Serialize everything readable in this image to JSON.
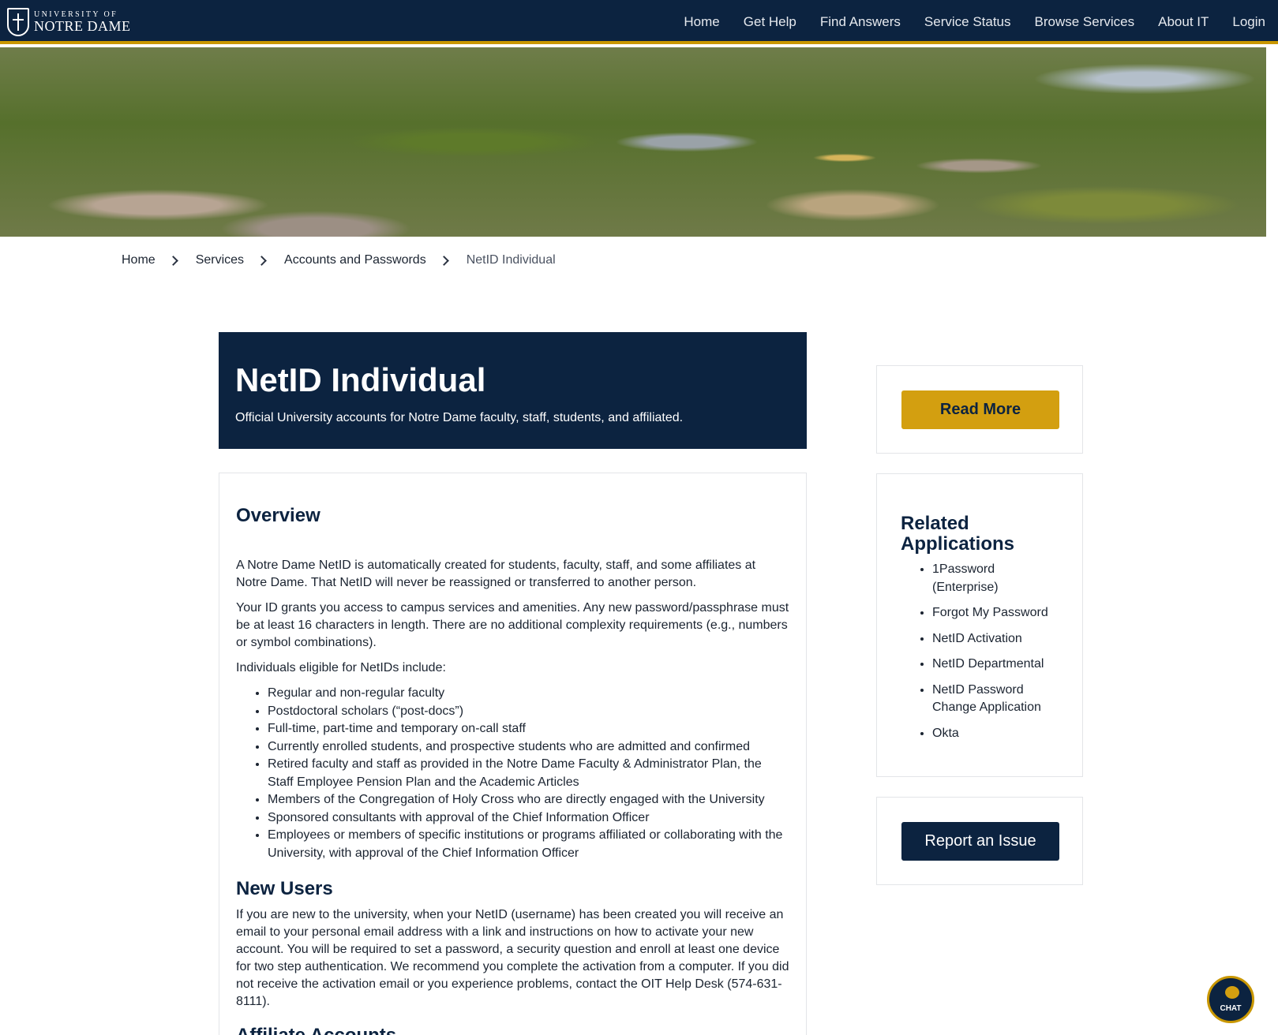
{
  "header": {
    "logo_line1": "UNIVERSITY OF",
    "logo_line2": "NOTRE DAME",
    "nav": [
      "Home",
      "Get Help",
      "Find Answers",
      "Service Status",
      "Browse Services",
      "About IT",
      "Login"
    ]
  },
  "breadcrumb": [
    "Home",
    "Services",
    "Accounts and Passwords",
    "NetID Individual"
  ],
  "banner": {
    "title": "NetID Individual",
    "subtitle": "Official University accounts for Notre Dame faculty, staff, students, and affiliated."
  },
  "overview": {
    "title": "Overview",
    "p1": "A Notre Dame NetID is automatically created for students, faculty, staff, and some affiliates at Notre Dame. That NetID will never be reassigned or transferred to another person.",
    "p2": "Your ID grants you access to campus services and amenities. Any new password/passphrase must be at least 16 characters in length. There are no additional complexity requirements (e.g., numbers or symbol combinations).",
    "p3": "Individuals eligible for NetIDs include:",
    "eligible": [
      "Regular and non-regular faculty",
      "Postdoctoral scholars (“post-docs”)",
      "Full-time, part-time and temporary on-call staff",
      "Currently enrolled students, and prospective students who are admitted and confirmed",
      "Retired faculty and staff as provided in the Notre Dame Faculty & Administrator Plan, the Staff Employee Pension Plan and the Academic Articles",
      "Members of the Congregation of Holy Cross who are directly engaged with the University",
      "Sponsored consultants with approval of the Chief Information Officer",
      "Employees or members of specific institutions or programs affiliated or collaborating with the University, with approval of the Chief Information Officer"
    ]
  },
  "new_users": {
    "title": "New Users",
    "text": "If you are new to the university, when your NetID (username) has been created you will receive an email to your personal email address with a link and instructions on how to activate your new account. You will be required to set a password, a security question and enroll at least one device for two step authentication. We recommend you complete the activation from a computer. If you did not receive the activation email or you experience problems, contact the OIT Help Desk (574-631-8111)."
  },
  "affiliate": {
    "title": "Affiliate Accounts"
  },
  "sidebar": {
    "read_more": "Read More",
    "related_title": "Related Applications",
    "related": [
      "1Password (Enterprise)",
      "Forgot My Password",
      "NetID Activation",
      "NetID Departmental",
      "NetID Password Change Application",
      "Okta"
    ],
    "report": "Report an Issue"
  },
  "chat": {
    "label": "CHAT"
  },
  "colors": {
    "navy": "#0c2340",
    "gold": "#d39f10"
  }
}
